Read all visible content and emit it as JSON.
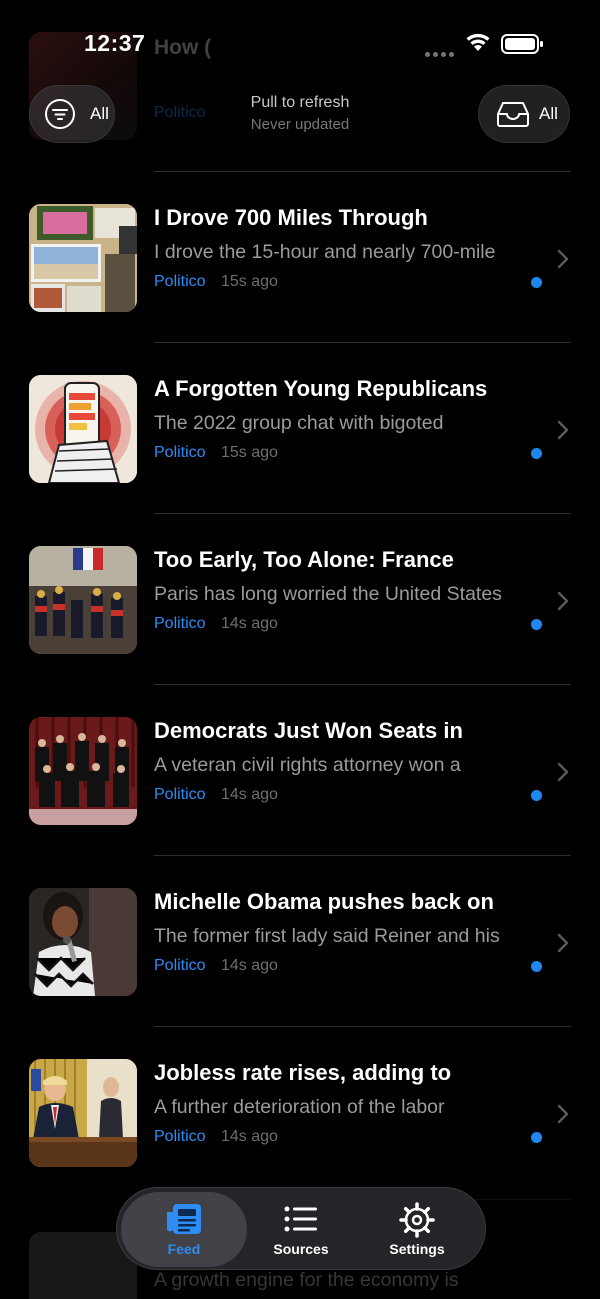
{
  "status_bar": {
    "time": "12:37"
  },
  "header": {
    "left_filter_label": "All",
    "right_filter_label": "All",
    "refresh_title": "Pull to refresh",
    "refresh_subtitle": "Never updated"
  },
  "feed": {
    "items": [
      {
        "title": "I Drove 700 Miles Through",
        "summary": "I drove the 15-hour and nearly 700-mile",
        "source": "Politico",
        "age": "15s ago",
        "unread": true
      },
      {
        "title": "A Forgotten Young Republicans",
        "summary": "The 2022 group chat with bigoted",
        "source": "Politico",
        "age": "15s ago",
        "unread": true
      },
      {
        "title": "Too Early, Too Alone: France",
        "summary": "Paris has long worried the United States",
        "source": "Politico",
        "age": "14s ago",
        "unread": true
      },
      {
        "title": "Democrats Just Won Seats in",
        "summary": "A veteran civil rights attorney won a",
        "source": "Politico",
        "age": "14s ago",
        "unread": true
      },
      {
        "title": "Michelle Obama pushes back on",
        "summary": "The former first lady said Reiner and his",
        "source": "Politico",
        "age": "14s ago",
        "unread": true
      },
      {
        "title": "Jobless rate rises, adding to",
        "summary": "A further deterioration of the labor",
        "source": "Politico",
        "age": "14s ago",
        "unread": true
      }
    ],
    "partial_bottom_summary": "A growth engine for the economy is"
  },
  "tabbar": {
    "feed_label": "Feed",
    "sources_label": "Sources",
    "settings_label": "Settings"
  },
  "colors": {
    "accent": "#2f8cf2",
    "background": "#000000",
    "unread_dot": "#1e88f0"
  }
}
